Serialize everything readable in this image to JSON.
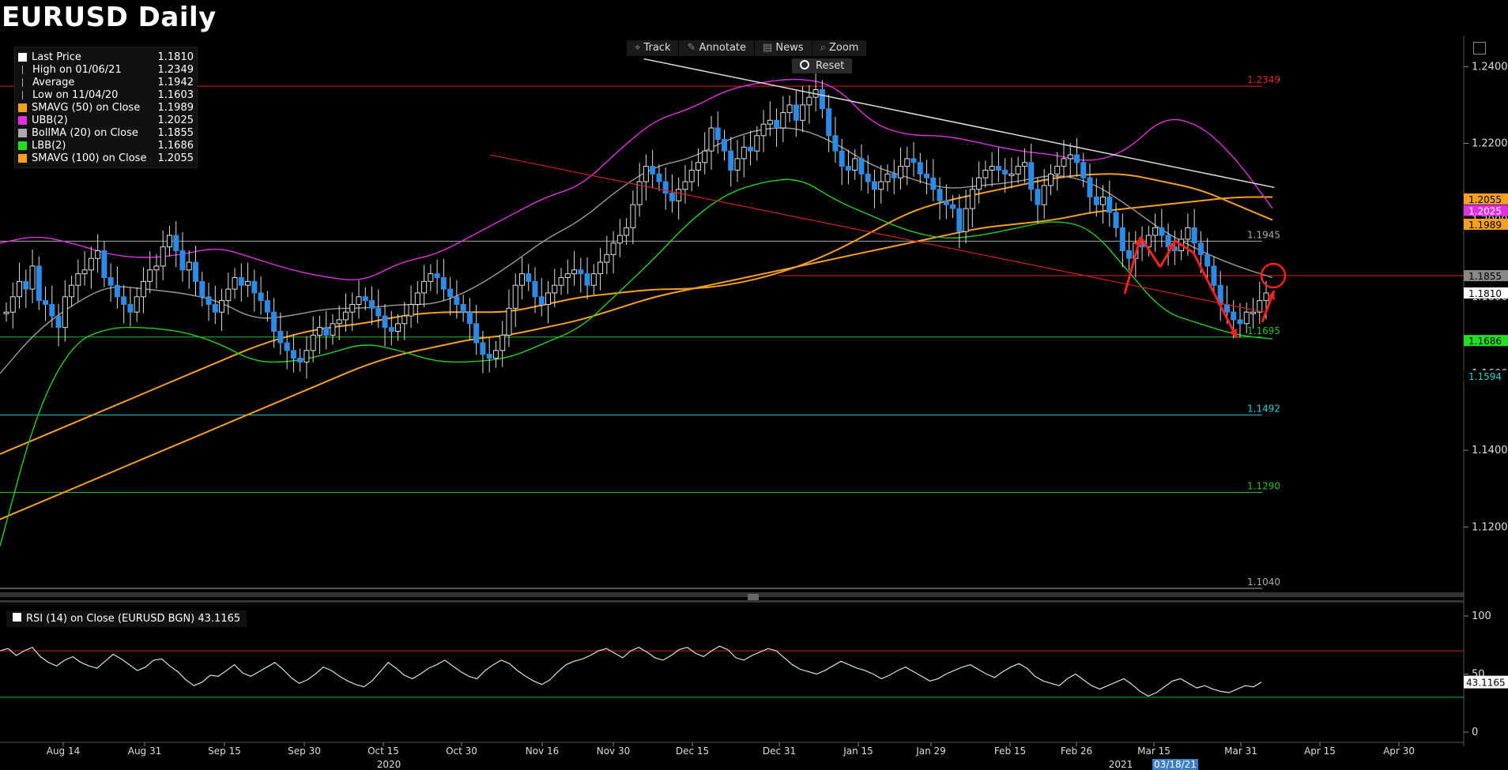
{
  "title": "EURUSD Daily",
  "toolbar": [
    {
      "icon": "crosshair-icon",
      "label": "Track"
    },
    {
      "icon": "pencil-icon",
      "label": "Annotate"
    },
    {
      "icon": "news-icon",
      "label": "News"
    },
    {
      "icon": "magnifier-icon",
      "label": "Zoom"
    }
  ],
  "reset_label": "Reset",
  "legend": [
    {
      "label": "Last Price",
      "value": "1.1810",
      "color": "#ffffff",
      "swatch": "square"
    },
    {
      "label": "High on 01/06/21",
      "value": "1.2349",
      "color": "#aaaaaa",
      "swatch": "high"
    },
    {
      "label": "Average",
      "value": "1.1942",
      "color": "#aaaaaa",
      "swatch": "avg"
    },
    {
      "label": "Low on 11/04/20",
      "value": "1.1603",
      "color": "#aaaaaa",
      "swatch": "low"
    },
    {
      "label": "SMAVG (50)  on Close",
      "value": "1.1989",
      "color": "#f5a020",
      "swatch": "square"
    },
    {
      "label": "UBB(2)",
      "value": "1.2025",
      "color": "#e030e0",
      "swatch": "square"
    },
    {
      "label": "BollMA (20)  on Close",
      "value": "1.1855",
      "color": "#aaaaaa",
      "swatch": "square"
    },
    {
      "label": "LBB(2)",
      "value": "1.1686",
      "color": "#20e020",
      "swatch": "square"
    },
    {
      "label": "SMAVG (100)  on Close",
      "value": "1.2055",
      "color": "#f5a020",
      "swatch": "square"
    }
  ],
  "rsi_legend": "RSI (14)  on Close (EURUSD BGN) 43.1165",
  "chart_data": {
    "type": "candlestick",
    "price_axis": {
      "ylim": [
        1.104,
        1.245
      ],
      "ticks": [
        "1.2400",
        "1.2200",
        "1.2000",
        "1.1800",
        "1.1600",
        "1.1400",
        "1.1200"
      ]
    },
    "x_ticks": [
      "Aug 14",
      "Aug 31",
      "Sep 15",
      "Sep 30",
      "Oct 15",
      "Oct 30",
      "Nov 16",
      "Nov 30",
      "Dec 15",
      "Dec 31",
      "Jan 15",
      "Jan 29",
      "Feb 15",
      "Feb 26",
      "Mar 15",
      "Mar 31",
      "Apr 15",
      "Apr 30"
    ],
    "x_years": [
      "2020",
      "2021"
    ],
    "x_highlight": "03/18/21",
    "levels": [
      {
        "label": "1.2349",
        "value": 1.2349,
        "color": "#e02020"
      },
      {
        "label": "1.1945",
        "value": 1.1945,
        "color": "#aaaaaa"
      },
      {
        "label": "1.1695",
        "value": 1.1695,
        "color": "#20c020"
      },
      {
        "label": "1.1492",
        "value": 1.1492,
        "color": "#20d0d0"
      },
      {
        "label": "1.1290",
        "value": 1.129,
        "color": "#20c020"
      },
      {
        "label": "1.1040",
        "value": 1.104,
        "color": "#aaaaaa"
      }
    ],
    "extra_level": 1.1855,
    "right_badges": [
      {
        "label": "1.2055",
        "value": 1.2055,
        "bg": "#f5a020",
        "fg": "#000"
      },
      {
        "label": "1.2025",
        "value": 1.2025,
        "bg": "#e030e0",
        "fg": "#fff"
      },
      {
        "label": "1.1989",
        "value": 1.1989,
        "bg": "#f5a020",
        "fg": "#000"
      },
      {
        "label": "1.1855",
        "value": 1.1855,
        "bg": "#888888",
        "fg": "#000"
      },
      {
        "label": "1.1810",
        "value": 1.181,
        "bg": "#ffffff",
        "fg": "#000"
      },
      {
        "label": "1.1686",
        "value": 1.1686,
        "bg": "#20e020",
        "fg": "#000"
      },
      {
        "label": "1.1594",
        "value": 1.1594,
        "bg": "#000000",
        "fg": "#20d0d0"
      }
    ],
    "closes": [
      1.176,
      1.18,
      1.184,
      1.182,
      1.188,
      1.179,
      1.178,
      1.175,
      1.172,
      1.18,
      1.183,
      1.186,
      1.187,
      1.19,
      1.192,
      1.185,
      1.183,
      1.18,
      1.178,
      1.176,
      1.18,
      1.184,
      1.187,
      1.188,
      1.193,
      1.196,
      1.192,
      1.187,
      1.189,
      1.184,
      1.18,
      1.178,
      1.176,
      1.179,
      1.182,
      1.185,
      1.183,
      1.184,
      1.181,
      1.179,
      1.176,
      1.171,
      1.168,
      1.166,
      1.164,
      1.163,
      1.166,
      1.17,
      1.172,
      1.17,
      1.173,
      1.174,
      1.176,
      1.178,
      1.18,
      1.179,
      1.177,
      1.175,
      1.172,
      1.171,
      1.173,
      1.175,
      1.178,
      1.181,
      1.184,
      1.186,
      1.185,
      1.182,
      1.18,
      1.178,
      1.176,
      1.173,
      1.168,
      1.165,
      1.164,
      1.166,
      1.17,
      1.177,
      1.183,
      1.186,
      1.184,
      1.18,
      1.178,
      1.181,
      1.183,
      1.185,
      1.186,
      1.187,
      1.186,
      1.183,
      1.186,
      1.189,
      1.191,
      1.194,
      1.196,
      1.198,
      1.204,
      1.21,
      1.214,
      1.212,
      1.21,
      1.207,
      1.205,
      1.208,
      1.21,
      1.213,
      1.215,
      1.218,
      1.224,
      1.221,
      1.218,
      1.213,
      1.216,
      1.219,
      1.218,
      1.222,
      1.225,
      1.226,
      1.224,
      1.228,
      1.23,
      1.226,
      1.23,
      1.232,
      1.234,
      1.229,
      1.222,
      1.218,
      1.214,
      1.213,
      1.216,
      1.212,
      1.21,
      1.208,
      1.21,
      1.212,
      1.211,
      1.214,
      1.216,
      1.215,
      1.212,
      1.211,
      1.208,
      1.205,
      1.204,
      1.203,
      1.197,
      1.203,
      1.208,
      1.211,
      1.213,
      1.214,
      1.213,
      1.212,
      1.212,
      1.214,
      1.215,
      1.208,
      1.204,
      1.209,
      1.212,
      1.214,
      1.216,
      1.217,
      1.215,
      1.211,
      1.206,
      1.204,
      1.206,
      1.202,
      1.198,
      1.192,
      1.19,
      1.194,
      1.193,
      1.196,
      1.198,
      1.196,
      1.193,
      1.192,
      1.195,
      1.198,
      1.194,
      1.191,
      1.188,
      1.183,
      1.178,
      1.176,
      1.174,
      1.173,
      1.176,
      1.176,
      1.179,
      1.181
    ],
    "moving_averages": {
      "sma50": [
        1.139,
        1.143,
        1.147,
        1.151,
        1.155,
        1.159,
        1.163,
        1.167,
        1.17,
        1.172,
        1.173,
        1.175,
        1.176,
        1.176,
        1.176,
        1.178,
        1.18,
        1.181,
        1.182,
        1.182,
        1.183,
        1.185,
        1.188,
        1.192,
        1.197,
        1.202,
        1.205,
        1.207,
        1.209,
        1.211,
        1.212,
        1.212,
        1.21,
        1.208,
        1.204,
        1.2
      ],
      "sma100": [
        1.122,
        1.126,
        1.13,
        1.134,
        1.138,
        1.142,
        1.146,
        1.15,
        1.154,
        1.158,
        1.162,
        1.165,
        1.167,
        1.169,
        1.17,
        1.172,
        1.174,
        1.177,
        1.18,
        1.182,
        1.184,
        1.186,
        1.188,
        1.19,
        1.192,
        1.194,
        1.196,
        1.198,
        1.199,
        1.2,
        1.202,
        1.203,
        1.204,
        1.205,
        1.206,
        1.206
      ],
      "ubb": [
        1.194,
        1.196,
        1.194,
        1.191,
        1.19,
        1.191,
        1.193,
        1.19,
        1.187,
        1.185,
        1.184,
        1.189,
        1.191,
        1.196,
        1.201,
        1.206,
        1.209,
        1.218,
        1.226,
        1.229,
        1.234,
        1.236,
        1.237,
        1.235,
        1.225,
        1.222,
        1.222,
        1.22,
        1.218,
        1.217,
        1.215,
        1.218,
        1.227,
        1.225,
        1.216,
        1.203
      ],
      "bollma": [
        1.16,
        1.171,
        1.178,
        1.183,
        1.182,
        1.181,
        1.179,
        1.174,
        1.175,
        1.177,
        1.177,
        1.178,
        1.178,
        1.182,
        1.188,
        1.195,
        1.2,
        1.208,
        1.214,
        1.216,
        1.221,
        1.224,
        1.224,
        1.22,
        1.214,
        1.211,
        1.208,
        1.209,
        1.21,
        1.212,
        1.21,
        1.204,
        1.197,
        1.192,
        1.188,
        1.185
      ],
      "lbb": [
        1.115,
        1.15,
        1.168,
        1.172,
        1.172,
        1.171,
        1.168,
        1.163,
        1.163,
        1.165,
        1.168,
        1.166,
        1.163,
        1.163,
        1.164,
        1.168,
        1.172,
        1.181,
        1.19,
        1.2,
        1.207,
        1.21,
        1.211,
        1.205,
        1.201,
        1.197,
        1.195,
        1.196,
        1.198,
        1.2,
        1.198,
        1.187,
        1.176,
        1.173,
        1.17,
        1.169
      ]
    },
    "rsi": {
      "ticks": [
        "100",
        "50",
        "0"
      ],
      "upper": 70,
      "lower": 30,
      "last": "43.1165",
      "values": [
        70,
        72,
        66,
        70,
        73,
        65,
        60,
        57,
        62,
        65,
        60,
        57,
        55,
        61,
        67,
        63,
        58,
        53,
        56,
        62,
        63,
        57,
        52,
        45,
        40,
        43,
        49,
        48,
        53,
        58,
        51,
        48,
        52,
        56,
        60,
        54,
        47,
        42,
        45,
        50,
        56,
        53,
        48,
        44,
        41,
        39,
        44,
        52,
        60,
        55,
        49,
        46,
        50,
        55,
        58,
        62,
        57,
        52,
        48,
        46,
        53,
        58,
        62,
        59,
        53,
        48,
        44,
        41,
        45,
        52,
        58,
        61,
        63,
        66,
        70,
        72,
        68,
        64,
        70,
        73,
        69,
        64,
        62,
        66,
        71,
        73,
        68,
        65,
        70,
        74,
        71,
        64,
        62,
        66,
        69,
        72,
        70,
        64,
        58,
        54,
        52,
        50,
        53,
        57,
        61,
        58,
        55,
        53,
        50,
        46,
        49,
        53,
        56,
        52,
        48,
        44,
        46,
        50,
        53,
        56,
        58,
        54,
        50,
        47,
        52,
        56,
        59,
        55,
        48,
        44,
        42,
        40,
        46,
        50,
        45,
        40,
        37,
        40,
        43,
        46,
        41,
        35,
        31,
        34,
        39,
        44,
        46,
        42,
        38,
        40,
        37,
        35,
        34,
        37,
        40,
        39,
        43
      ]
    },
    "annotations": {
      "trendline_white": [
        [
          0.427,
          1.242
        ],
        [
          0.845,
          1.2085
        ]
      ],
      "trendline_red": [
        [
          0.325,
          1.217
        ],
        [
          0.845,
          1.176
        ]
      ],
      "circle_value": 1.1855
    }
  }
}
